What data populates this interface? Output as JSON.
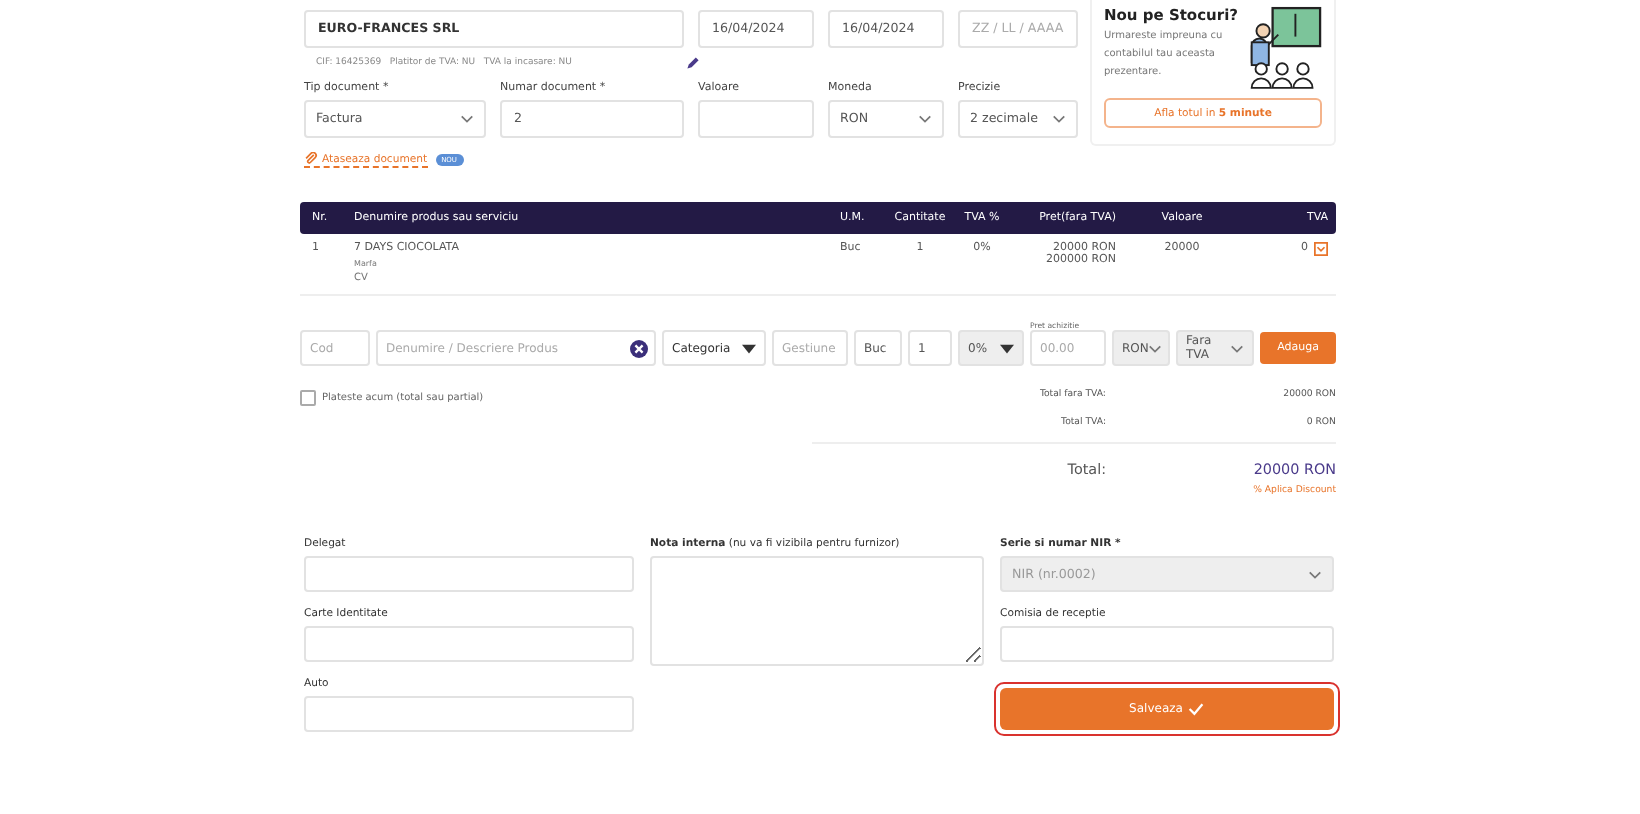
{
  "header_fields": [
    {
      "kind": "input",
      "value": "EURO-FRANCES SRL"
    },
    {
      "kind": "input",
      "value": "16/04/2024"
    },
    {
      "kind": "input",
      "value": "16/04/2024"
    },
    {
      "kind": "input",
      "placeholder": "ZZ / LL / AAAA"
    }
  ],
  "supplier_info": "CIF: 16425369   Platitor de TVA: NU   TVA la incasare: NU",
  "document_fields": [
    {
      "label": "Tip document *",
      "kind": "select",
      "value": "Factura"
    },
    {
      "label": "Numar document *",
      "kind": "input",
      "value": "2"
    },
    {
      "label": "Valoare",
      "kind": "input"
    },
    {
      "label": "Moneda",
      "kind": "select",
      "value": "RON"
    },
    {
      "label": "Precizie",
      "kind": "select",
      "value": "2 zecimale"
    }
  ],
  "attach_link": {
    "label": "Ataseaza document",
    "badge": "NOU"
  },
  "promo_card": {
    "title": "Nou pe Stocuri?",
    "text": "Urmareste impreuna cu contabilul tau aceasta prezentare.",
    "button": "Afla totul in **5 minute**"
  },
  "table": {
    "columns": [
      "Nr.",
      "Denumire produs sau serviciu",
      "U.M.",
      "Cantitate",
      "TVA %",
      "Pret(fara TVA)",
      "Valoare",
      "TVA"
    ],
    "rows": [
      {
        "nr": "1",
        "name": "7 DAYS CIOCOLATA",
        "details": [
          "Marfa",
          "CV"
        ],
        "unit": "Buc",
        "quantity": "1",
        "vat_rate": "0%",
        "prices": [
          "20000 RON",
          "200000 RON"
        ],
        "value": "20000",
        "vat": "0"
      }
    ]
  },
  "add_row": {
    "fields": [
      {
        "kind": "input",
        "placeholder": "Cod"
      },
      {
        "kind": "clearable",
        "placeholder": "Denumire / Descriere Produs"
      },
      {
        "kind": "dropdown",
        "value": "Categoria"
      },
      {
        "kind": "input",
        "placeholder": "Gestiune"
      },
      {
        "kind": "input",
        "value": "Buc"
      },
      {
        "kind": "input",
        "value": "1"
      },
      {
        "kind": "dropdown",
        "value": "0%"
      },
      {
        "kind": "input",
        "placeholder": "00.00",
        "label": "Pret achizitie"
      },
      {
        "kind": "select",
        "value": "RON"
      },
      {
        "kind": "select",
        "value": "Fara TVA"
      }
    ],
    "button": "Adauga"
  },
  "pay_now": {
    "label": "Plateste acum (total sau partial)",
    "checked": false
  },
  "totals": [
    {
      "label": "Total fara TVA:",
      "value": "20000 RON",
      "kind": "sub"
    },
    {
      "label": "Total TVA:",
      "value": "0 RON",
      "kind": "sub"
    },
    {
      "label": "Total:",
      "value": "20000 RON",
      "kind": "grand"
    }
  ],
  "discount_link": "% Aplica Discount",
  "delegate_fields": [
    {
      "label": "Delegat"
    },
    {
      "label": "Carte Identitate"
    },
    {
      "label": "Auto"
    }
  ],
  "internal_note": {
    "label": "**Nota interna** (nu va fi vizibila pentru furnizor)"
  },
  "nir_series": {
    "label": "Serie si numar NIR *",
    "value": "NIR (nr.0002)",
    "disabled": true
  },
  "reception_committee": {
    "label": "Comisia de receptie"
  },
  "save_button": {
    "label": "Salveaza",
    "focused": true
  }
}
